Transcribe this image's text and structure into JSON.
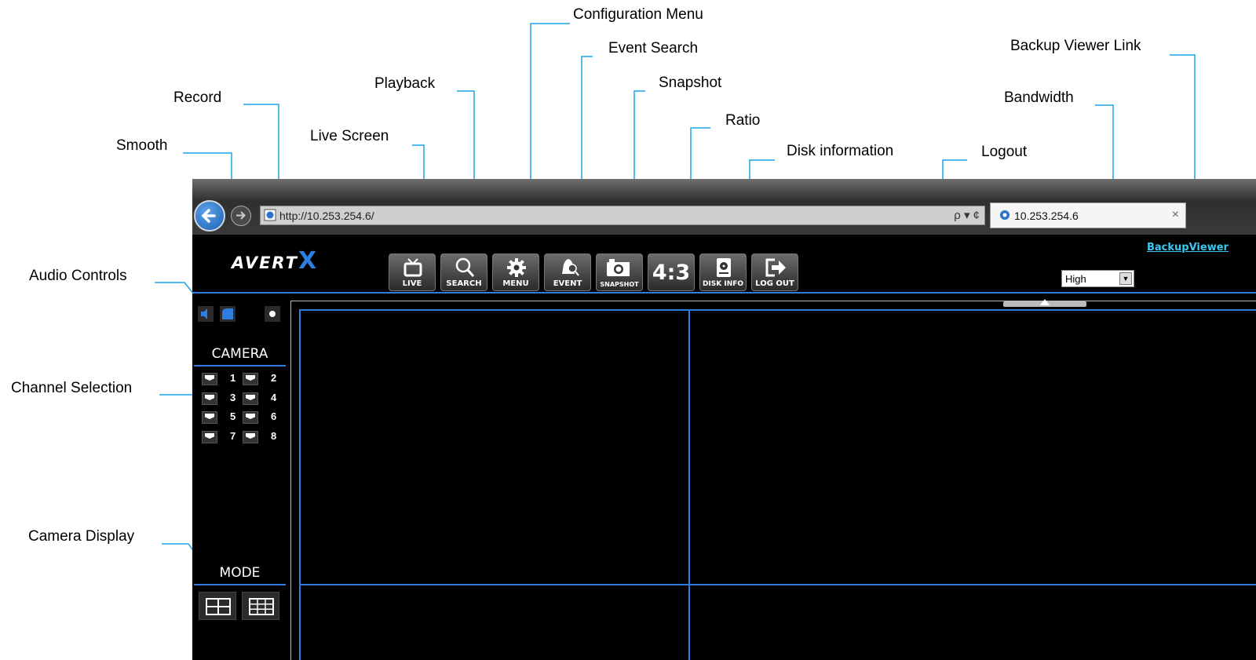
{
  "callouts": {
    "configuration_menu": "Configuration Menu",
    "event_search": "Event Search",
    "backup_viewer_link": "Backup Viewer Link",
    "playback": "Playback",
    "snapshot": "Snapshot",
    "record": "Record",
    "bandwidth": "Bandwidth",
    "ratio": "Ratio",
    "live_screen": "Live Screen",
    "smooth": "Smooth",
    "disk_information": "Disk information",
    "logout": "Logout",
    "audio_controls": "Audio Controls",
    "channel_selection": "Channel Selection",
    "camera_display": "Camera Display"
  },
  "browser": {
    "address": "http://10.253.254.6/",
    "tab_title": "10.253.254.6",
    "tab_close": "×",
    "address_tools": "ρ ▾ ¢"
  },
  "app": {
    "logo_text": "AVERT",
    "logo_x": "X",
    "toolbar": [
      {
        "label": "LIVE",
        "icon": "tv-icon"
      },
      {
        "label": "SEARCH",
        "icon": "magnifier-icon"
      },
      {
        "label": "MENU",
        "icon": "gear-icon"
      },
      {
        "label": "EVENT",
        "icon": "alarm-bell-icon"
      },
      {
        "label": "SNAPSHOT",
        "icon": "camera-icon"
      },
      {
        "label": "4:3",
        "icon": "ratio-icon"
      },
      {
        "label": "DISK INFO",
        "icon": "disk-icon"
      },
      {
        "label": "LOG OUT",
        "icon": "logout-icon"
      }
    ],
    "bandwidth_value": "High",
    "backup_link": "BackupViewer",
    "camera_header": "CAMERA",
    "channels": [
      "1",
      "2",
      "3",
      "4",
      "5",
      "6",
      "7",
      "8"
    ],
    "mode_header": "MODE",
    "accent_color": "#2f7de0"
  }
}
